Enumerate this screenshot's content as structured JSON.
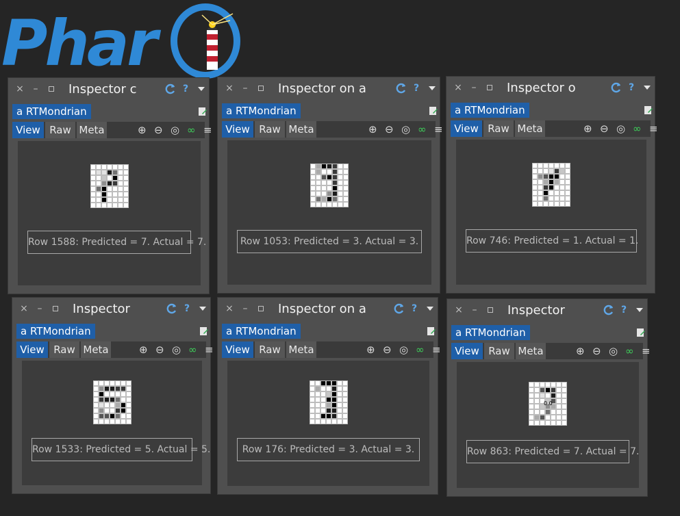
{
  "logo": {
    "text": "Phar"
  },
  "windows": [
    {
      "title": "Inspector c",
      "object_label": "a RTMondrian",
      "tabs": [
        "View",
        "Raw",
        "Meta"
      ],
      "caption": "Row 1588: Predicted = 7. Actual = 7.",
      "pixels": [
        "0000000",
        "0118500",
        "0020900",
        "0048700",
        "0590000",
        "0090000",
        "0090000",
        "0000000"
      ]
    },
    {
      "title": "Inspector on a",
      "object_label": "a RTMondrian",
      "tabs": [
        "View",
        "Raw",
        "Meta"
      ],
      "caption": "Row 1053: Predicted = 3. Actual = 3.",
      "pixels": [
        "0398700",
        "0300700",
        "0069700",
        "0000700",
        "0000900",
        "0004800",
        "0539500",
        "0000000"
      ]
    },
    {
      "title": "Inspector o",
      "object_label": "a RTMondrian",
      "tabs": [
        "View",
        "Raw",
        "Meta"
      ],
      "caption": "Row 746: Predicted = 1. Actual = 1.",
      "pixels": [
        "0000000",
        "0001720",
        "0469900",
        "0039300",
        "0079000",
        "0090000",
        "0050000",
        "0000000"
      ]
    },
    {
      "title": "Inspector",
      "object_label": "a RTMondrian",
      "tabs": [
        "View",
        "Raw",
        "Meta"
      ],
      "caption": "Row 1533: Predicted = 5. Actual = 5.",
      "pixels": [
        "0000000",
        "0488770",
        "0900000",
        "0788500",
        "0100390",
        "0400790",
        "0669500",
        "0000000"
      ]
    },
    {
      "title": "Inspector on a",
      "object_label": "a RTMondrian",
      "tabs": [
        "View",
        "Raw",
        "Meta"
      ],
      "caption": "Row 176: Predicted = 3. Actual = 3.",
      "pixels": [
        "0099900",
        "0300800",
        "0002900",
        "0009900",
        "0003900",
        "0008800",
        "0099800",
        "0000000"
      ]
    },
    {
      "title": "Inspector",
      "object_label": "a RTMondrian",
      "tabs": [
        "View",
        "Raw",
        "Meta"
      ],
      "caption": "Row 863: Predicted = 7. Actual = 7.",
      "pixels": [
        "0000000",
        "0069700",
        "0010800",
        "0002600",
        "0024300",
        "0005000",
        "0360000",
        "0000000"
      ],
      "overlay": "0.0"
    }
  ]
}
